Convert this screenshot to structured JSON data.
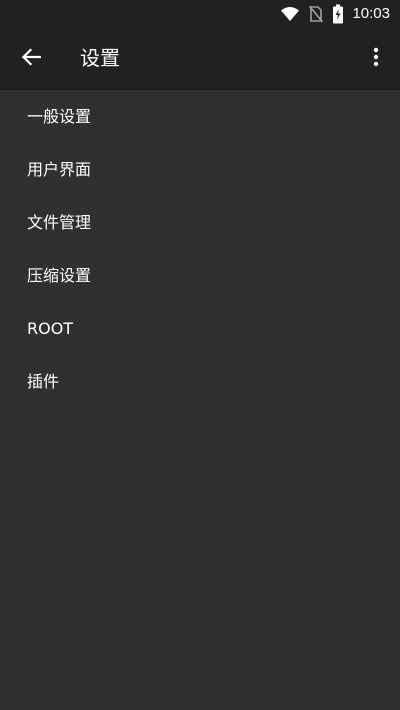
{
  "status_bar": {
    "time": "10:03",
    "icons": [
      "wifi-icon",
      "no-sim-icon",
      "battery-charging-icon"
    ]
  },
  "app_bar": {
    "back_icon": "arrow-left-icon",
    "title": "设置",
    "overflow_icon": "more-vert-icon"
  },
  "settings": {
    "items": [
      {
        "label": "一般设置"
      },
      {
        "label": "用户界面"
      },
      {
        "label": "文件管理"
      },
      {
        "label": "压缩设置"
      },
      {
        "label": "ROOT"
      },
      {
        "label": "插件"
      }
    ]
  },
  "colors": {
    "background": "#303030",
    "app_bar": "#212121",
    "text": "#ffffff"
  }
}
